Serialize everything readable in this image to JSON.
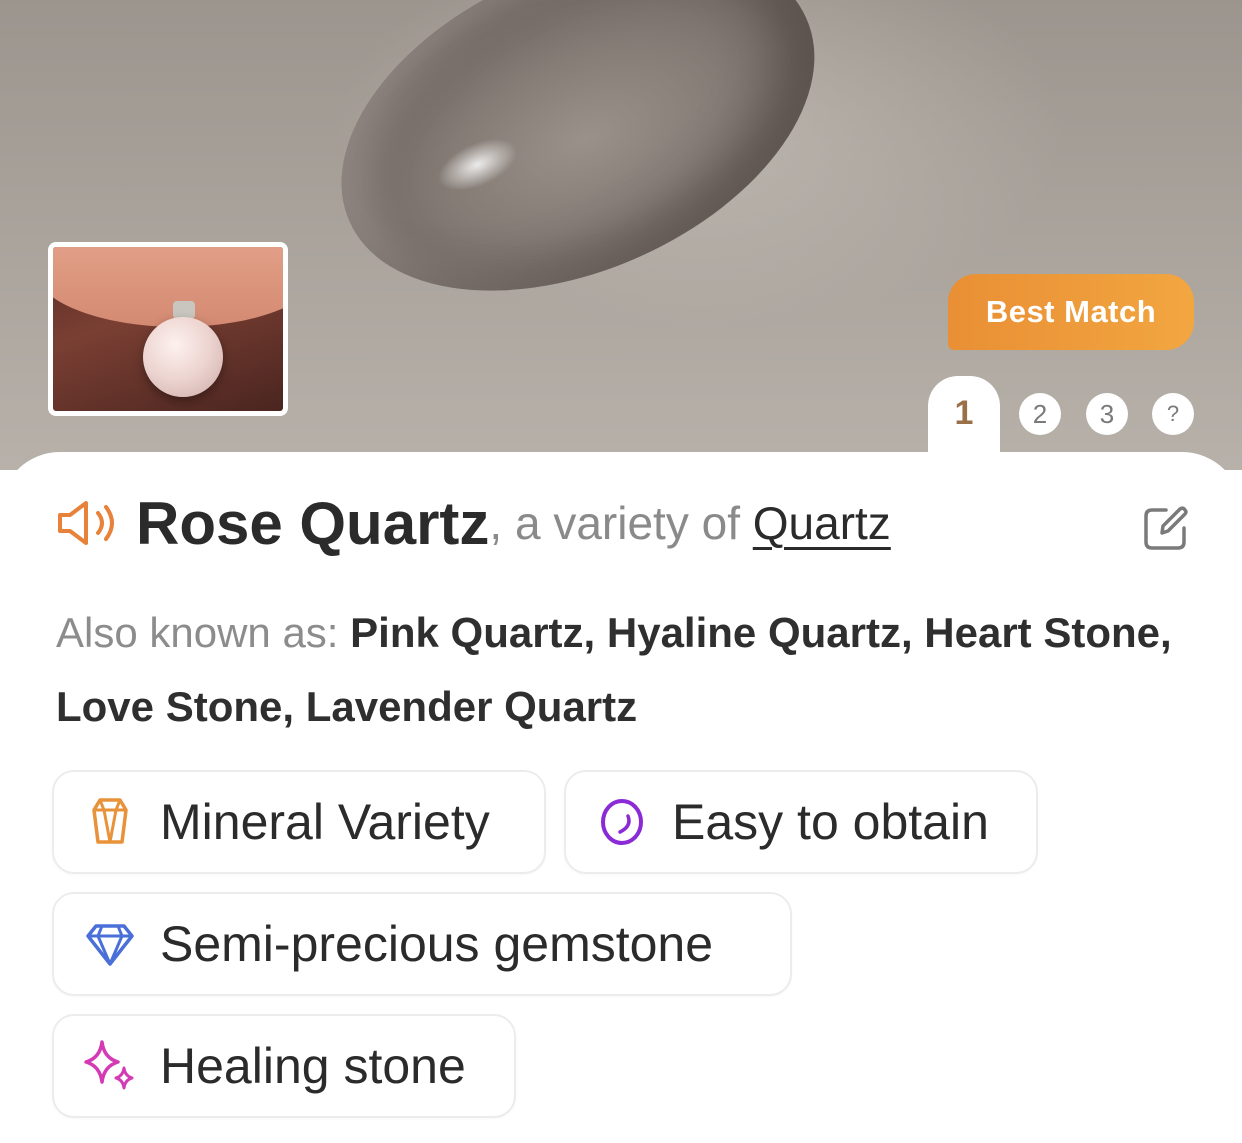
{
  "hero": {
    "badge_label": "Best Match",
    "pager": [
      "1",
      "2",
      "3",
      "?"
    ],
    "active_page": "1"
  },
  "result": {
    "name": "Rose Quartz",
    "variety_text": ", a variety of ",
    "parent": "Quartz",
    "aka_label": "Also known as: ",
    "aka_names": "Pink Quartz, Hyaline Quartz, Heart Stone, Love Stone, Lavender Quartz"
  },
  "tags": [
    {
      "label": "Mineral Variety",
      "icon": "crystal-icon",
      "color": "#e8923a"
    },
    {
      "label": "Easy to obtain",
      "icon": "circle-icon",
      "color": "#8a2bd6"
    },
    {
      "label": "Semi-precious gemstone",
      "icon": "diamond-icon",
      "color": "#4a6fd8"
    },
    {
      "label": "Healing stone",
      "icon": "sparkle-icon",
      "color": "#d53ab5"
    }
  ],
  "colors": {
    "accent": "#e98f35",
    "speaker": "#e8823a"
  }
}
